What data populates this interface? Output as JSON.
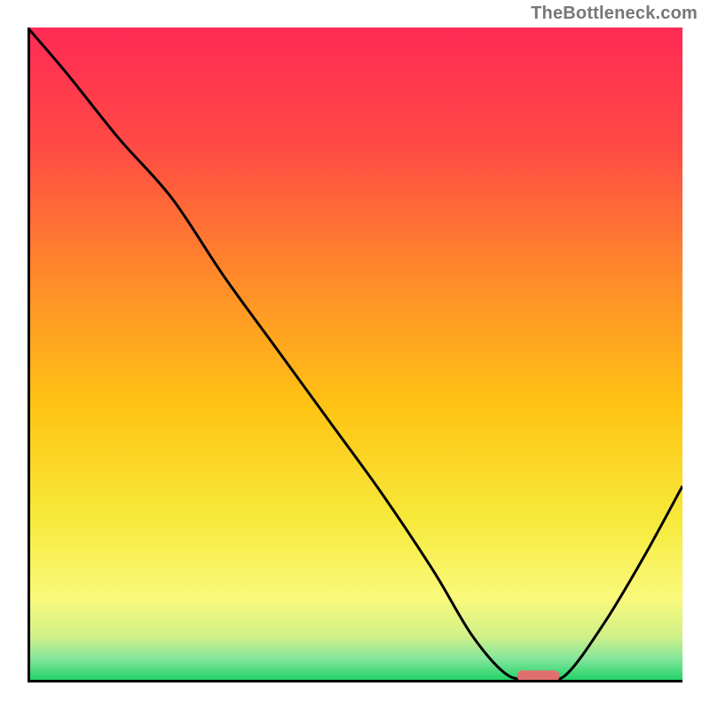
{
  "watermark": "TheBottleneck.com",
  "chart_data": {
    "type": "line",
    "title": "",
    "xlabel": "",
    "ylabel": "",
    "xlim": [
      0,
      100
    ],
    "ylim": [
      0,
      100
    ],
    "grid": false,
    "series": [
      {
        "name": "curve",
        "x": [
          0,
          6,
          14,
          22,
          30,
          38,
          46,
          54,
          62,
          68,
          73.5,
          78,
          82,
          88,
          94,
          100
        ],
        "y": [
          100,
          93,
          83,
          74,
          62,
          51,
          40,
          29,
          17,
          7,
          1,
          1,
          1,
          9,
          19,
          30
        ]
      }
    ],
    "markers": [
      {
        "name": "target-marker",
        "x": 78,
        "y": 1,
        "width_pct": 6.5,
        "height_pct": 1.7,
        "color": "#e07070",
        "radius_pct": 0.85
      }
    ],
    "gradient_stops": [
      {
        "offset": 0.0,
        "color": "#ff2a55"
      },
      {
        "offset": 0.18,
        "color": "#ff4a45"
      },
      {
        "offset": 0.38,
        "color": "#ff8a2a"
      },
      {
        "offset": 0.58,
        "color": "#ffc414"
      },
      {
        "offset": 0.75,
        "color": "#f6e93a"
      },
      {
        "offset": 0.87,
        "color": "#faf97a"
      },
      {
        "offset": 0.93,
        "color": "#d0f088"
      },
      {
        "offset": 0.965,
        "color": "#7fe59a"
      },
      {
        "offset": 1.0,
        "color": "#18d060"
      }
    ]
  }
}
